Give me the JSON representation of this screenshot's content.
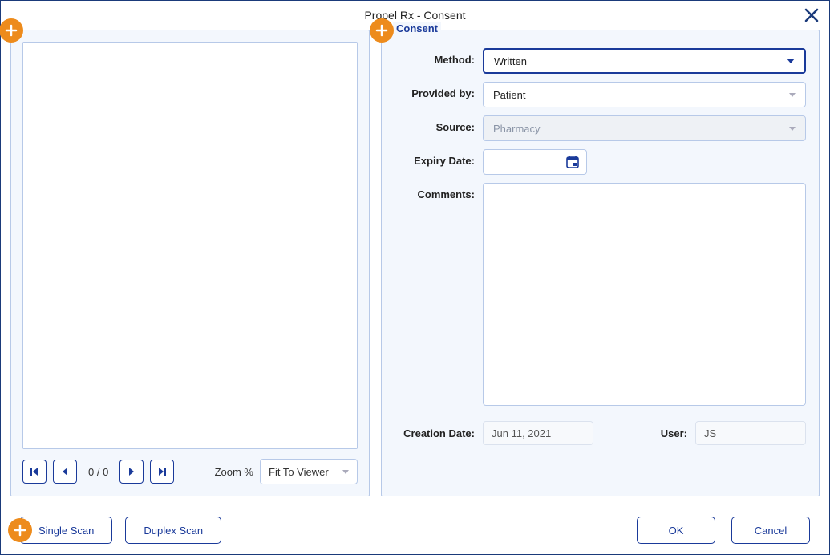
{
  "window": {
    "title": "Propel Rx - Consent"
  },
  "panel_right": {
    "legend": "Consent"
  },
  "form": {
    "method": {
      "label": "Method:",
      "value": "Written"
    },
    "provided_by": {
      "label": "Provided by:",
      "value": "Patient"
    },
    "source": {
      "label": "Source:",
      "value": "Pharmacy"
    },
    "expiry": {
      "label": "Expiry Date:",
      "value": ""
    },
    "comments": {
      "label": "Comments:",
      "value": ""
    },
    "creation": {
      "label": "Creation Date:",
      "value": "Jun 11, 2021"
    },
    "user": {
      "label": "User:",
      "value": "JS"
    }
  },
  "viewer": {
    "page_count": "0 / 0",
    "zoom_label": "Zoom %",
    "zoom_value": "Fit To Viewer"
  },
  "buttons": {
    "single_scan": "Single Scan",
    "duplex_scan": "Duplex Scan",
    "ok": "OK",
    "cancel": "Cancel"
  }
}
